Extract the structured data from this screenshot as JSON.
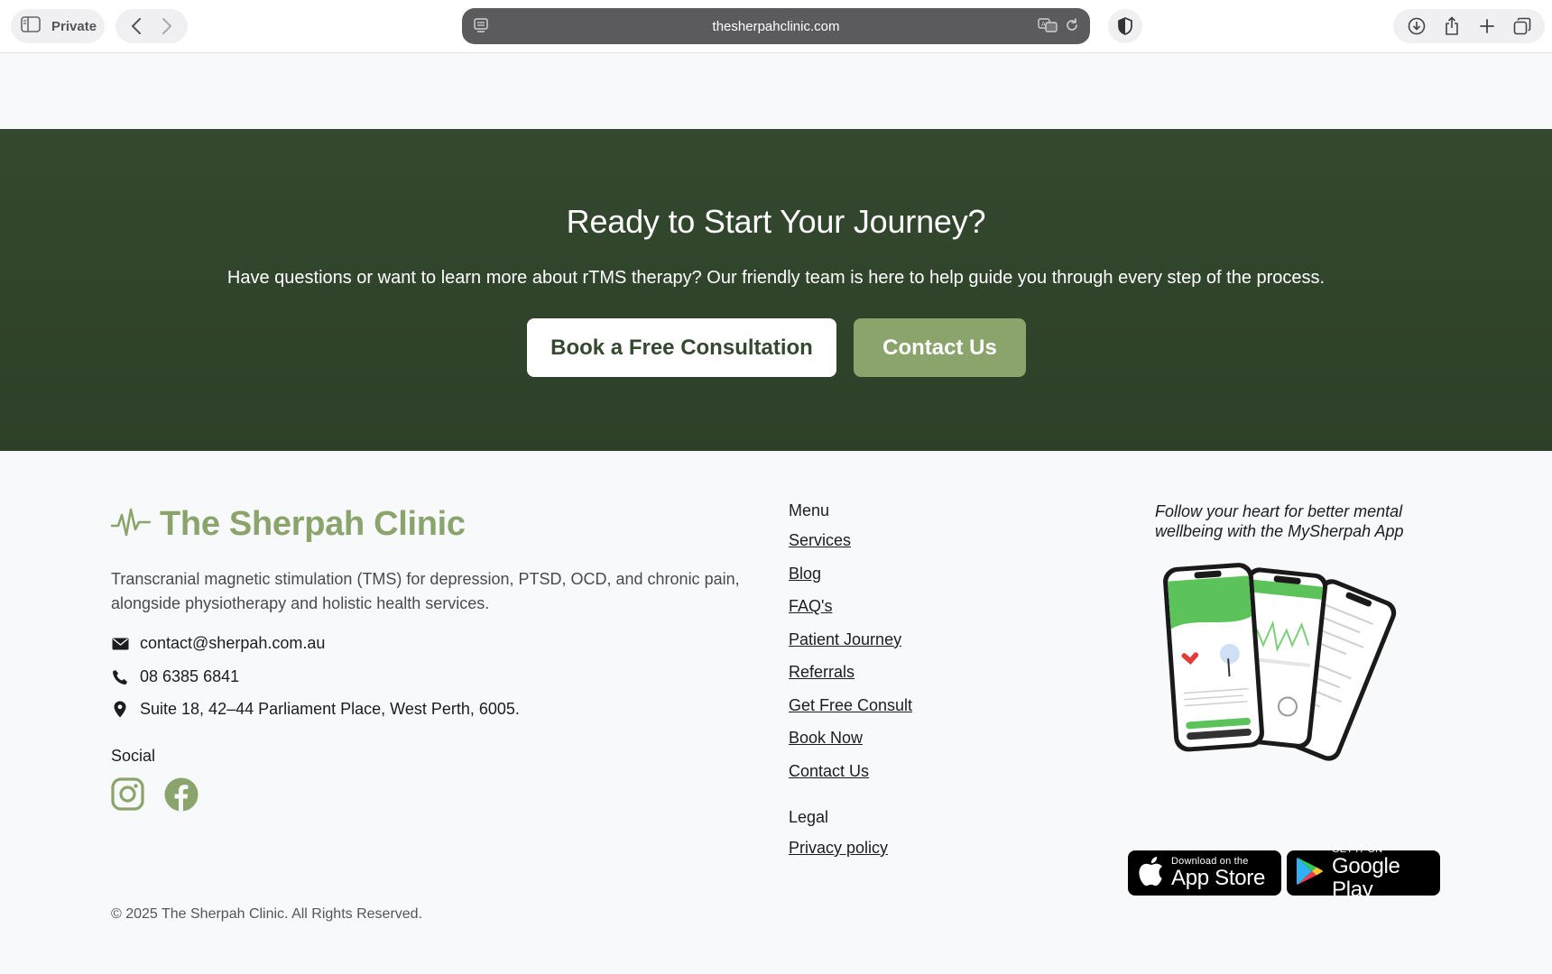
{
  "browser": {
    "private_label": "Private",
    "url": "thesherpahclinic.com"
  },
  "cta": {
    "title": "Ready to Start Your Journey?",
    "subtitle": "Have questions or want to learn more about rTMS therapy? Our friendly team is here to help guide you through every step of the process.",
    "primary_button": "Book a Free Consultation",
    "secondary_button": "Contact Us"
  },
  "footer": {
    "brand_name": "The Sherpah Clinic",
    "description": "Transcranial magnetic stimulation (TMS) for depression, PTSD, OCD, and chronic pain, alongside physiotherapy and holistic health services.",
    "email": "contact@sherpah.com.au",
    "phone": "08 6385 6841",
    "address": "Suite 18, 42–44 Parliament Place, West Perth, 6005.",
    "social_title": "Social",
    "menu_title": "Menu",
    "menu_items": [
      {
        "label": "Services"
      },
      {
        "label": "Blog"
      },
      {
        "label": "FAQ's"
      },
      {
        "label": "Patient Journey"
      },
      {
        "label": "Referrals"
      },
      {
        "label": "Get Free Consult"
      },
      {
        "label": "Book Now"
      },
      {
        "label": "Contact Us"
      }
    ],
    "legal_title": "Legal",
    "legal_items": [
      {
        "label": "Privacy policy"
      }
    ],
    "app_tagline": "Follow your heart for better mental wellbeing with the MySherpah App",
    "app_store": {
      "small": "Download on the",
      "big": "App Store"
    },
    "google_play": {
      "small": "GET IT ON",
      "big": "Google Play"
    },
    "copyright": "© 2025 The Sherpah Clinic. All Rights Reserved."
  },
  "colors": {
    "cta_bg": "#34492f",
    "brand_green": "#8aa46c",
    "footer_bg": "#f8f9fa"
  }
}
